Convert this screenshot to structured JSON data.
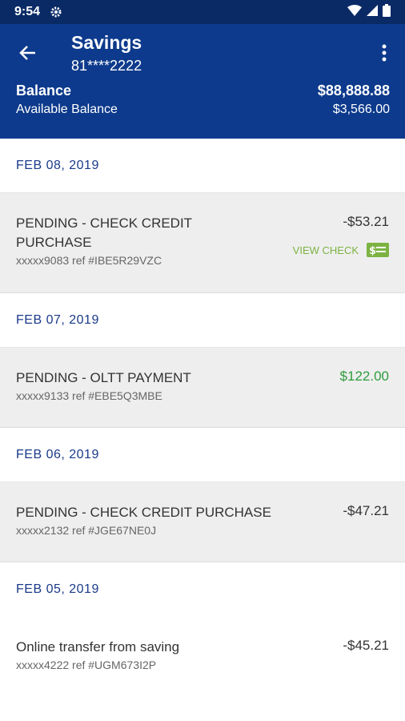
{
  "status_bar": {
    "time": "9:54"
  },
  "header": {
    "title": "Savings",
    "account": "81****2222",
    "balance_label": "Balance",
    "balance_value": "$88,888.88",
    "available_label": "Available Balance",
    "available_value": "$3,566.00"
  },
  "transactions": [
    {
      "date": "FEB 08, 2019",
      "description": "PENDING - CHECK CREDIT PURCHASE",
      "ref": "xxxxx9083 ref #IBE5R29VZC",
      "amount": "-$53.21",
      "action": "VIEW CHECK"
    },
    {
      "date": "FEB 07, 2019",
      "description": "PENDING - OLTT PAYMENT",
      "ref": "xxxxx9133 ref #EBE5Q3MBE",
      "amount": "$122.00"
    },
    {
      "date": "FEB 06, 2019",
      "description": "PENDING - CHECK CREDIT PURCHASE",
      "ref": "xxxxx2132 ref #JGE67NE0J",
      "amount": "-$47.21"
    },
    {
      "date": "FEB 05, 2019",
      "description": "Online transfer from saving",
      "ref": "xxxxx4222 ref #UGM673I2P",
      "amount": "-$45.21"
    }
  ],
  "colors": {
    "header_bg": "#0d3a8c",
    "status_bg": "#0a2a66",
    "date_text": "#1a3a8a",
    "credit_green": "#2e9b3c",
    "view_check_green": "#7cb342"
  },
  "icons": [
    "gear-icon",
    "wifi-icon",
    "signal-icon",
    "battery-icon",
    "back-arrow-icon",
    "more-vert-icon",
    "check-icon"
  ]
}
